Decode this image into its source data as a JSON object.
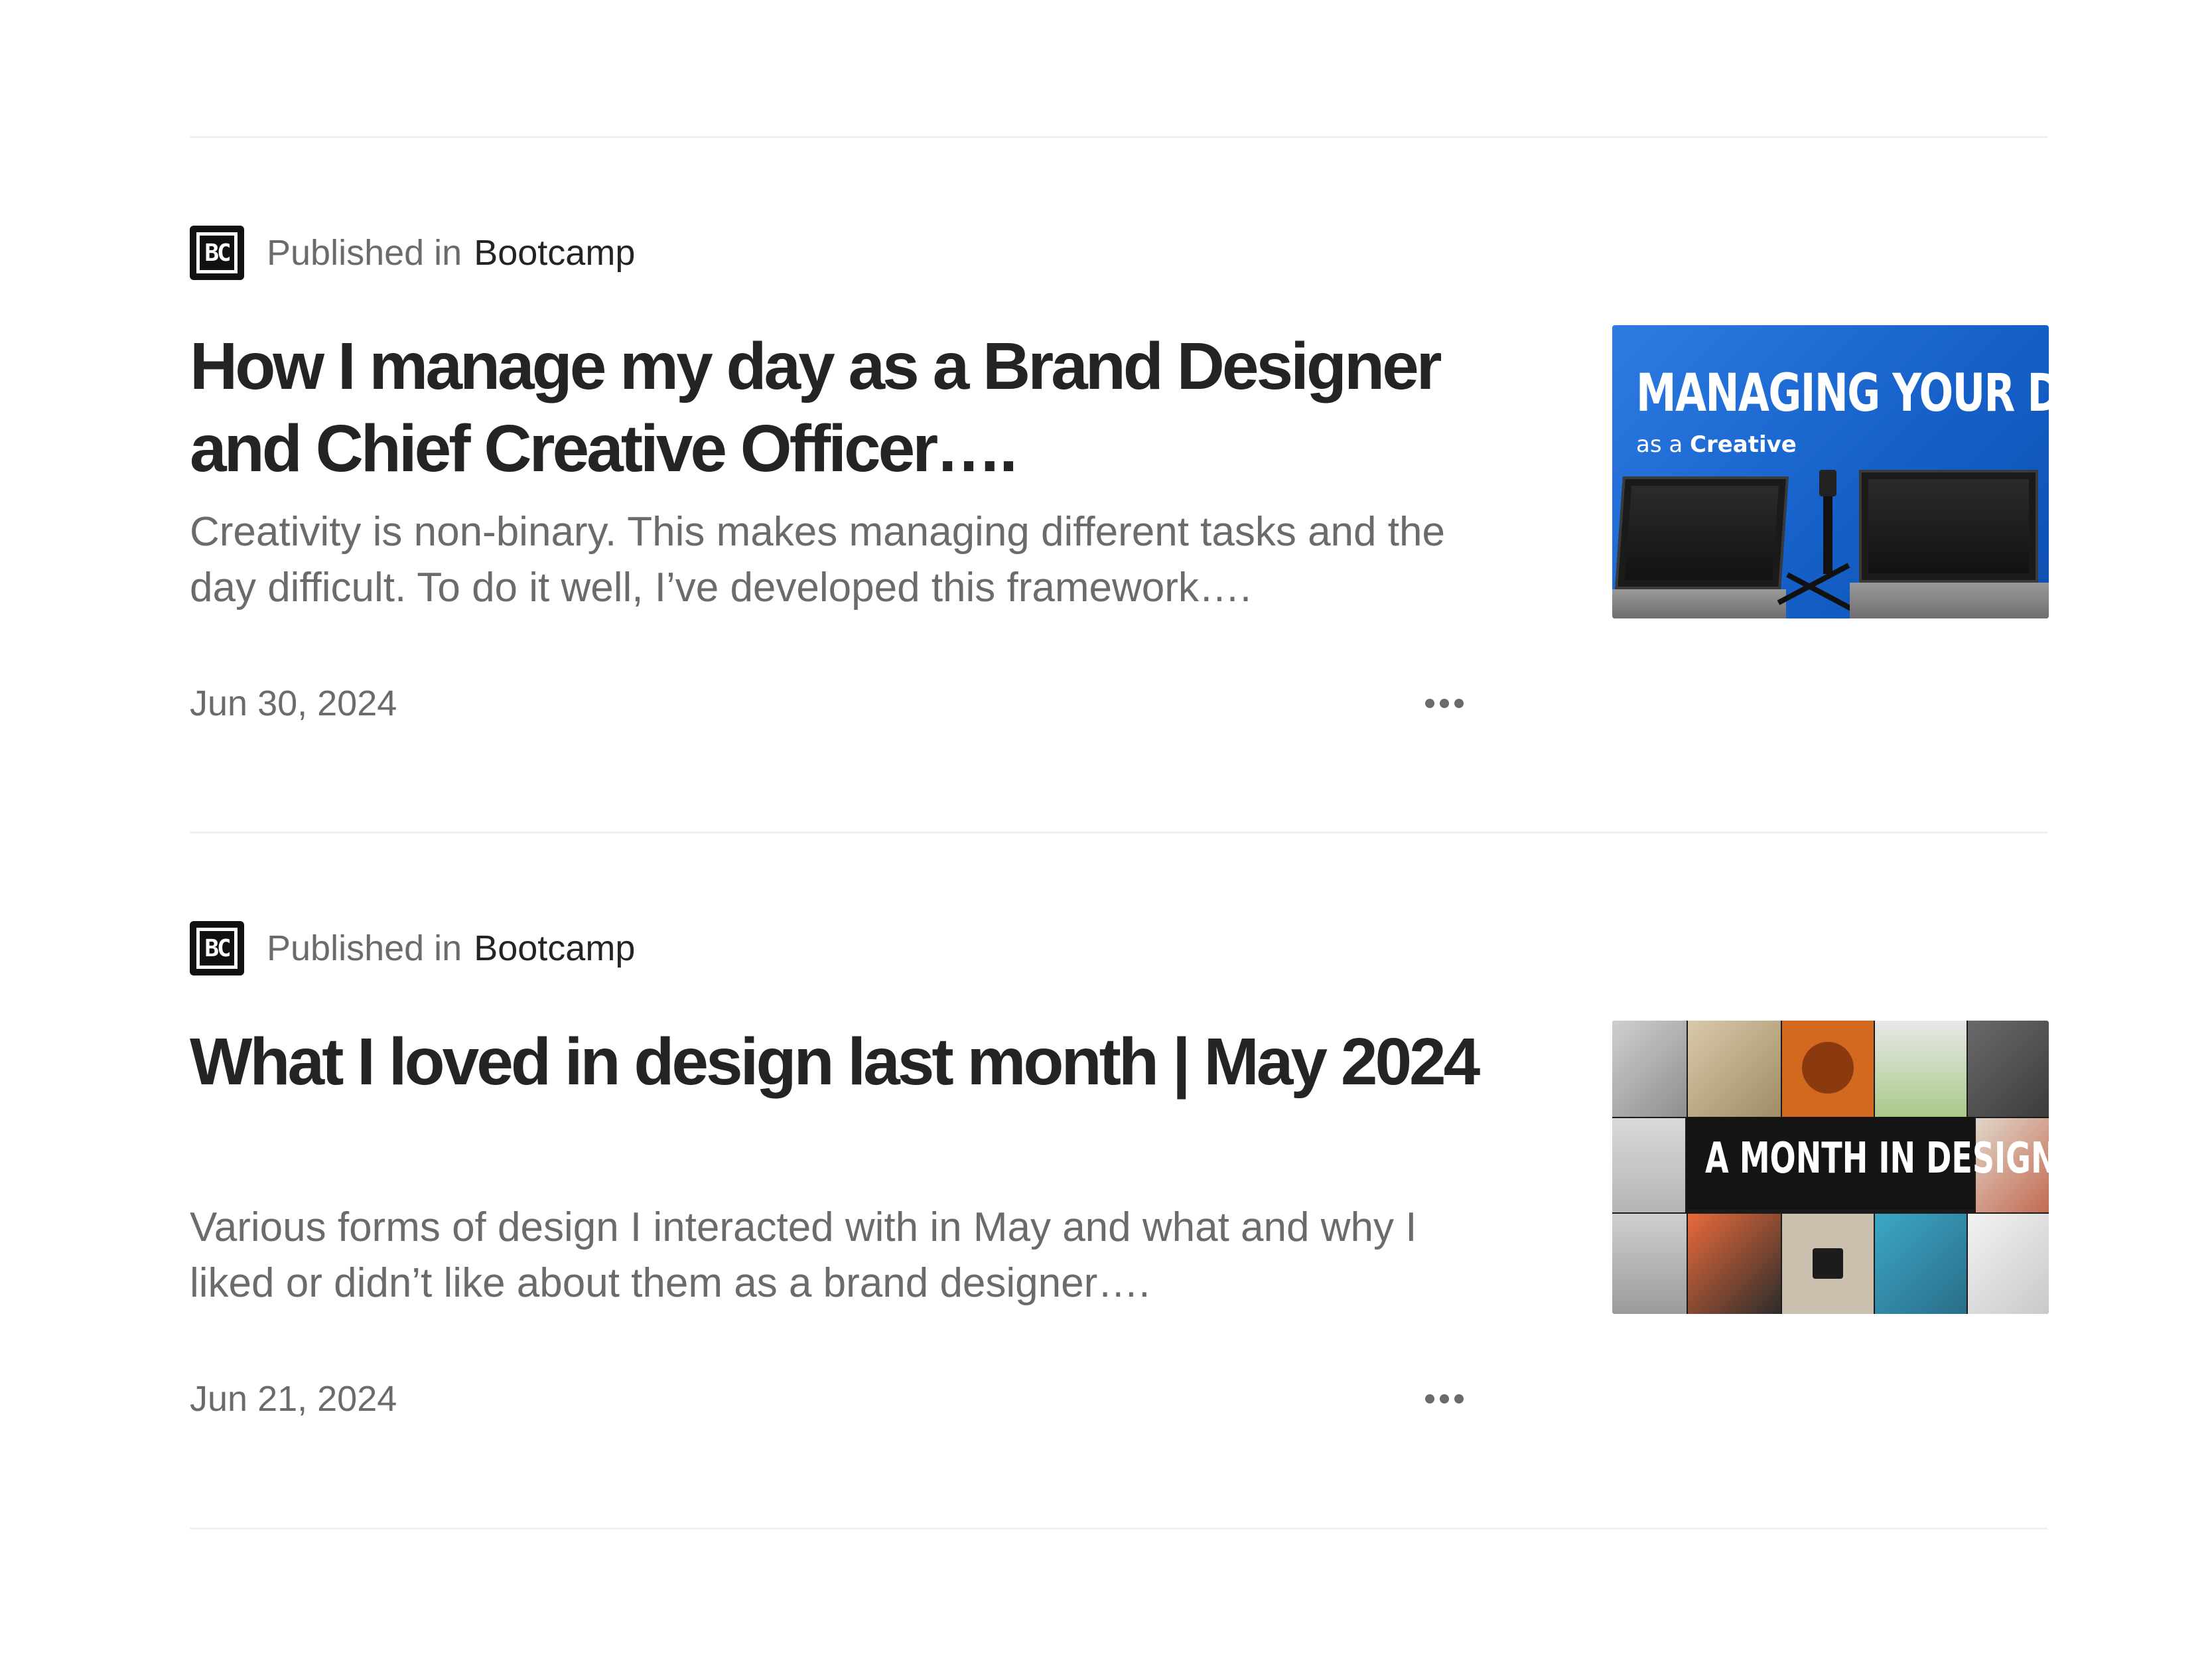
{
  "articles": [
    {
      "publication_prefix": "Published in",
      "publication_name": "Bootcamp",
      "publication_logo": "BC",
      "title": "How I manage my day as a Brand Designer and Chief Creative Officer….",
      "excerpt": "Creativity is non-binary. This makes managing different tasks and the day difficult. To do it well, I’ve developed this framework….",
      "date": "Jun 30, 2024",
      "more_icon": "more-horizontal-icon",
      "thumbnail": {
        "heading": "MANAGING YOUR DAY",
        "subheading_prefix": "as a",
        "subheading_bold": "Creative"
      }
    },
    {
      "publication_prefix": "Published in",
      "publication_name": "Bootcamp",
      "publication_logo": "BC",
      "title": "What I loved in design last month | May 2024",
      "excerpt": "Various forms of design I interacted with in May and what and why I liked or didn’t like about them as a brand designer….",
      "date": "Jun 21, 2024",
      "more_icon": "more-horizontal-icon",
      "thumbnail": {
        "heading": "A MONTH IN DESIGN"
      }
    }
  ],
  "colors": {
    "title": "#242424",
    "secondary_text": "#6b6b6b",
    "divider": "#f0f0f0",
    "thumb1_blue": "#1561c9"
  }
}
